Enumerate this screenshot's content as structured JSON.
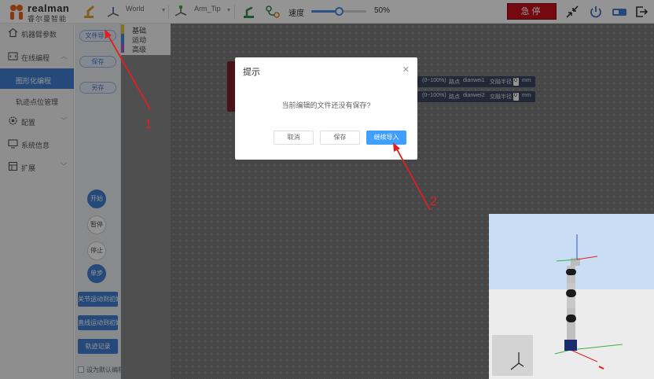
{
  "header": {
    "brand": "realman",
    "brand_sub": "睿尔曼智能",
    "frame_select": "World",
    "tool_select": "Arm_Tip",
    "speed_label": "速度",
    "speed_value": "50%",
    "speed_percent": 50,
    "estop_label": "急停"
  },
  "sidebar": {
    "items": [
      {
        "label": "机器臂参数",
        "icon": "home-icon"
      },
      {
        "label": "在线编程",
        "icon": "code-icon"
      },
      {
        "label": "配置",
        "icon": "gear-icon"
      },
      {
        "label": "系统信息",
        "icon": "monitor-icon"
      },
      {
        "label": "扩展",
        "icon": "extension-icon"
      }
    ],
    "sub_items": [
      {
        "label": "图形化编程",
        "active": true
      },
      {
        "label": "轨迹点位管理",
        "active": false
      }
    ]
  },
  "palette": {
    "pills": [
      "文件导入",
      "保存",
      "另存"
    ],
    "run_buttons": [
      "开始",
      "暂停",
      "停止",
      "单步"
    ],
    "action_buttons": [
      "关节运动到初始位",
      "直线运动到初始位",
      "轨迹记录"
    ],
    "default_checkbox_label": "设为默认编程"
  },
  "categories": [
    {
      "label": "基础",
      "color": "#e8c23a"
    },
    {
      "label": "运动",
      "color": "#3b8ed8"
    },
    {
      "label": "高级",
      "color": "#9b5dc7"
    }
  ],
  "workspace_blocks": {
    "row1": {
      "range": "(0~100%)",
      "label": "路点",
      "select": "dianwei1",
      "mode": "交融半径",
      "value": "0",
      "unit": "mm"
    },
    "row2": {
      "range": "(0~100%)",
      "label": "路点",
      "select": "dianwei2",
      "mode": "交融半径",
      "value": "0",
      "unit": "mm"
    }
  },
  "dialog": {
    "title": "提示",
    "message": "当前编辑的文件还没有保存?",
    "buttons": {
      "cancel": "取消",
      "save": "保存",
      "continue": "继续导入"
    }
  },
  "annotations": {
    "marker1": "1",
    "marker2": "2"
  },
  "colors": {
    "accent": "#409eff",
    "estop": "#c8101b",
    "sidebar_active": "#3f7fd3"
  }
}
